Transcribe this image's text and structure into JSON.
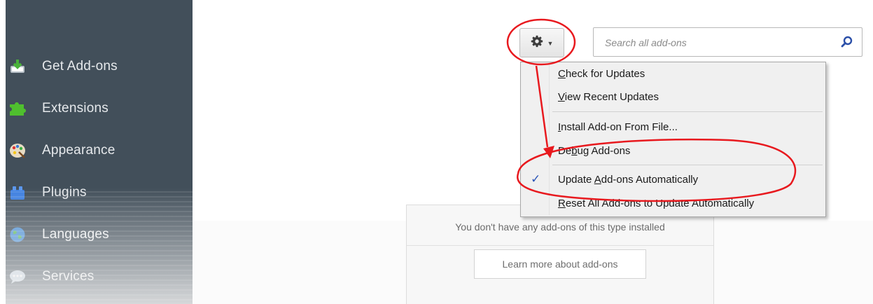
{
  "sidebar": {
    "items": [
      {
        "label": "Get Add-ons",
        "icon": "get-addons-icon"
      },
      {
        "label": "Extensions",
        "icon": "puzzle-piece-icon"
      },
      {
        "label": "Appearance",
        "icon": "palette-icon"
      },
      {
        "label": "Plugins",
        "icon": "lego-brick-icon"
      },
      {
        "label": "Languages",
        "icon": "globe-icon"
      },
      {
        "label": "Services",
        "icon": "chat-cloud-icon"
      }
    ]
  },
  "toolbar": {
    "tools_button_icon": "gear-icon",
    "search": {
      "placeholder": "Search all add-ons",
      "value": ""
    }
  },
  "tools_menu": {
    "items": [
      {
        "pre": "",
        "key": "C",
        "post": "heck for Updates",
        "checked": false
      },
      {
        "pre": "",
        "key": "V",
        "post": "iew Recent Updates",
        "checked": false
      },
      {
        "pre": "",
        "key": "I",
        "post": "nstall Add-on From File...",
        "checked": false
      },
      {
        "pre": "De",
        "key": "b",
        "post": "ug Add-ons",
        "checked": false
      },
      {
        "pre": "Update ",
        "key": "A",
        "post": "dd-ons Automatically",
        "checked": true
      },
      {
        "pre": "",
        "key": "R",
        "post": "eset All Add-ons to Update Automatically",
        "checked": false
      }
    ],
    "check_glyph": "✓"
  },
  "empty_notice": {
    "message": "You don't have any add-ons of this type installed",
    "learn_more": "Learn more about add-ons"
  },
  "colors": {
    "sidebar_bg": "#424f5a",
    "annotation_red": "#e8191e",
    "checkmark_blue": "#2a55b8"
  }
}
